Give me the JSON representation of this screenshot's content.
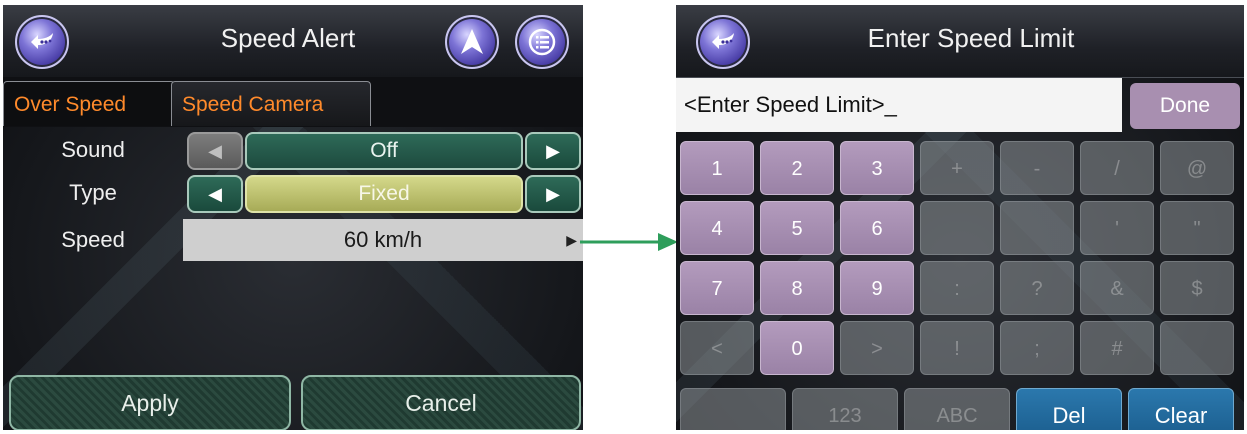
{
  "screen1": {
    "title": "Speed Alert",
    "back_icon": "back-icon",
    "nav_icon": "navigation-arrow-icon",
    "menu_icon": "menu-list-icon",
    "tabs": [
      {
        "label": "Over Speed",
        "active": true
      },
      {
        "label": "Speed Camera",
        "active": false
      }
    ],
    "rows": {
      "sound": {
        "label": "Sound",
        "value": "Off"
      },
      "type": {
        "label": "Type",
        "value": "Fixed"
      },
      "speed": {
        "label": "Speed",
        "value": "60 km/h"
      }
    },
    "buttons": {
      "apply": "Apply",
      "cancel": "Cancel"
    },
    "colors": {
      "tab_text": "#ff8a2b",
      "toggle_green": "#2e6a58",
      "fixed_yellow": "#c4c87a"
    }
  },
  "connector": {
    "color": "#2e9e5b"
  },
  "screen2": {
    "title": "Enter Speed Limit",
    "back_icon": "back-icon",
    "input_placeholder": "<Enter Speed Limit>_",
    "done": "Done",
    "keys": [
      [
        "1",
        "2",
        "3",
        "+",
        "-",
        "/",
        "@"
      ],
      [
        "4",
        "5",
        "6",
        "",
        "",
        "'",
        "\""
      ],
      [
        "7",
        "8",
        "9",
        ":",
        "?",
        "&",
        "$"
      ],
      [
        "<",
        "0",
        ">",
        "!",
        ";",
        "#",
        ""
      ]
    ],
    "bottom_keys": [
      "",
      "123",
      "ABC",
      "Del",
      "Clear"
    ],
    "colors": {
      "num_key": "#a88fb0",
      "action_key": "#1f6a9c"
    }
  }
}
